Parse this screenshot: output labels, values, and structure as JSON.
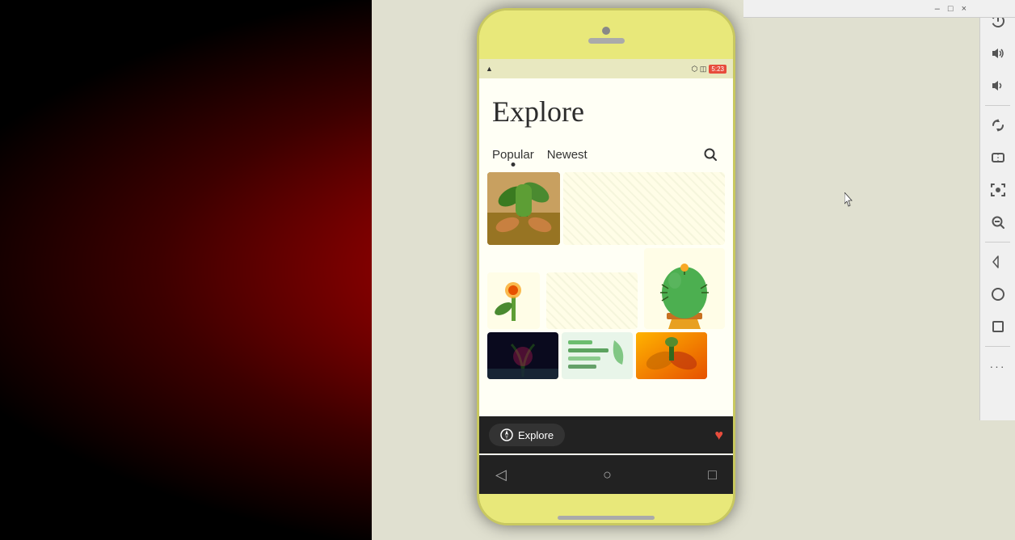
{
  "background": {
    "color": "#000000"
  },
  "window": {
    "title_bar": {
      "minimize_label": "–",
      "maximize_label": "□",
      "close_label": "×"
    }
  },
  "phone": {
    "status_bar": {
      "left_icon": "▲",
      "time": "5:23",
      "battery_icon": "🔋"
    },
    "app": {
      "title": "Explore",
      "filter_tabs": [
        {
          "label": "Popular",
          "active": true
        },
        {
          "label": "Newest",
          "active": false
        }
      ],
      "search_placeholder": "Search",
      "grid_images": [
        {
          "id": "hands-plant",
          "type": "plant-hands"
        },
        {
          "id": "small-flower",
          "type": "flower"
        },
        {
          "id": "round-cactus",
          "type": "cactus-round"
        },
        {
          "id": "dark-plant",
          "type": "dark"
        },
        {
          "id": "green-text",
          "type": "green"
        },
        {
          "id": "orange-hands",
          "type": "orange"
        }
      ]
    },
    "tab_bar": {
      "explore_label": "Explore",
      "heart_icon": "♥"
    },
    "nav_bar": {
      "back_label": "◁",
      "home_label": "○",
      "recent_label": "□"
    }
  },
  "side_toolbar": {
    "buttons": [
      {
        "icon": "⏻",
        "name": "power-icon",
        "label": "Power"
      },
      {
        "icon": "🔊",
        "name": "volume-up-icon",
        "label": "Volume Up"
      },
      {
        "icon": "🔈",
        "name": "volume-down-icon",
        "label": "Volume Down"
      },
      {
        "icon": "◇",
        "name": "rotate-icon",
        "label": "Rotate"
      },
      {
        "icon": "◈",
        "name": "orientation-icon",
        "label": "Orientation"
      },
      {
        "icon": "📷",
        "name": "screenshot-icon",
        "label": "Screenshot"
      },
      {
        "icon": "🔍",
        "name": "zoom-icon",
        "label": "Zoom"
      },
      {
        "icon": "△",
        "name": "back-icon",
        "label": "Back"
      },
      {
        "icon": "○",
        "name": "home-icon",
        "label": "Home"
      },
      {
        "icon": "□",
        "name": "recent-icon",
        "label": "Recent"
      },
      {
        "icon": "···",
        "name": "more-icon",
        "label": "More"
      }
    ]
  }
}
